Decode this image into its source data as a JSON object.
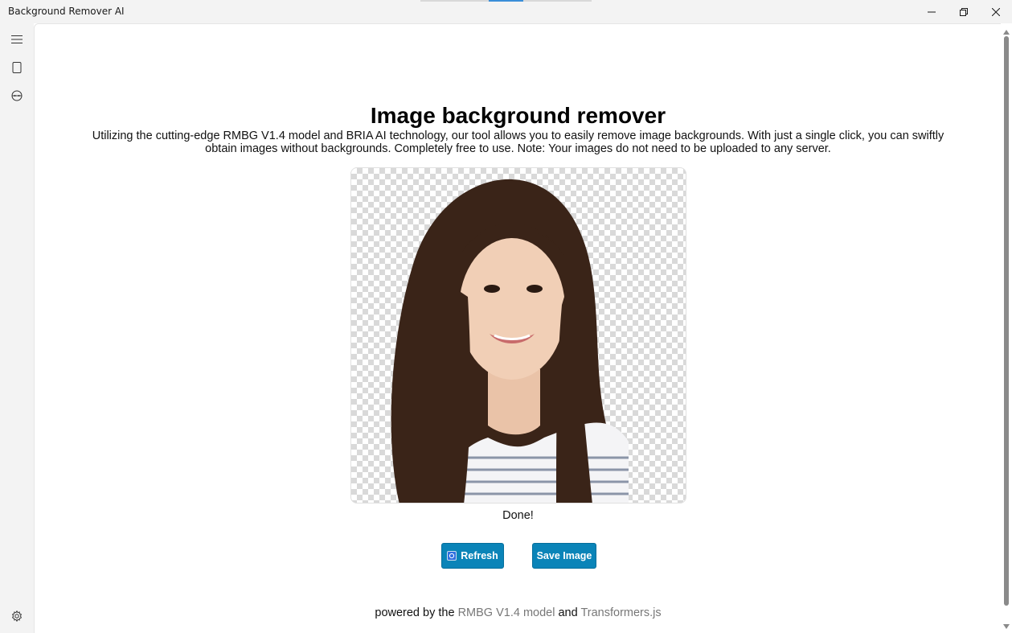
{
  "window": {
    "title": "Background Remover AI",
    "controls": [
      "minimize",
      "restore",
      "close"
    ]
  },
  "nav": {
    "items": [
      {
        "name": "menu",
        "icon": "hamburger-menu-icon"
      },
      {
        "name": "device",
        "icon": "tablet-icon"
      },
      {
        "name": "web",
        "icon": "globe-icon"
      }
    ],
    "settings_icon": "gear-icon"
  },
  "main": {
    "title": "Image background remover",
    "description": "Utilizing the cutting-edge RMBG V1.4 model and BRIA AI technology, our tool allows you to easily remove image backgrounds. With just a single click, you can swiftly obtain images without backgrounds. Completely free to use. Note: Your images do not need to be uploaded to any server.",
    "status": "Done!",
    "refresh_label": "Refresh",
    "save_label": "Save Image"
  },
  "footer": {
    "prefix": "powered by the ",
    "model_link": "RMBG V1.4 model",
    "conjunction": " and ",
    "lib_link": "Transformers.js"
  },
  "colors": {
    "accent": "#0a84b8",
    "link": "#777777",
    "chrome": "#f3f3f3"
  }
}
